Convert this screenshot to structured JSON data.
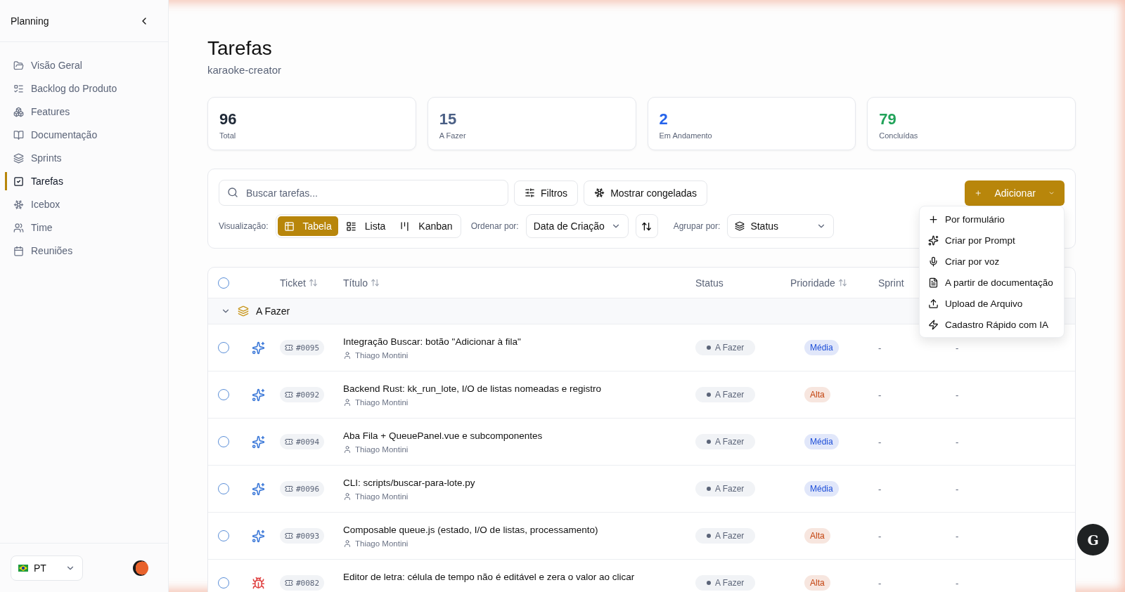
{
  "sidebar": {
    "title": "Planning",
    "items": [
      {
        "label": "Visão Geral",
        "selected": false
      },
      {
        "label": "Backlog do Produto",
        "selected": false
      },
      {
        "label": "Features",
        "selected": false
      },
      {
        "label": "Documentação",
        "selected": false
      },
      {
        "label": "Sprints",
        "selected": false
      },
      {
        "label": "Tarefas",
        "selected": true
      },
      {
        "label": "Icebox",
        "selected": false
      },
      {
        "label": "Time",
        "selected": false
      },
      {
        "label": "Reuniões",
        "selected": false
      }
    ],
    "language": "PT"
  },
  "header": {
    "title": "Tarefas",
    "subtitle": "karaoke-creator"
  },
  "stats": [
    {
      "value": "96",
      "label": "Total",
      "color": "#1f2937"
    },
    {
      "value": "15",
      "label": "A Fazer",
      "color": "#4a5f85"
    },
    {
      "value": "2",
      "label": "Em Andamento",
      "color": "#2563eb"
    },
    {
      "value": "79",
      "label": "Concluídas",
      "color": "#22a35a"
    }
  ],
  "toolbar": {
    "search_placeholder": "Buscar tarefas...",
    "filters": "Filtros",
    "frozen": "Mostrar congeladas",
    "add": "Adicionar",
    "view_label": "Visualização:",
    "views": [
      {
        "label": "Tabela",
        "selected": true
      },
      {
        "label": "Lista",
        "selected": false
      },
      {
        "label": "Kanban",
        "selected": false
      }
    ],
    "sort_label": "Ordenar por:",
    "sort_value": "Data de Criação",
    "group_label": "Agrupar por:",
    "group_value": "Status"
  },
  "add_menu": {
    "items": [
      {
        "label": "Por formulário"
      },
      {
        "label": "Criar por Prompt"
      },
      {
        "label": "Criar por voz"
      },
      {
        "label": "A partir de documentação"
      },
      {
        "label": "Upload de Arquivo"
      },
      {
        "label": "Cadastro Rápido com IA"
      }
    ]
  },
  "table": {
    "all_selected": false,
    "columns": [
      {
        "label": "Ticket",
        "sortable": true
      },
      {
        "label": "Título",
        "sortable": true
      },
      {
        "label": "Status",
        "sortable": false
      },
      {
        "label": "Prioridade",
        "sortable": true
      },
      {
        "label": "Sprint",
        "sortable": false
      }
    ],
    "group": {
      "label": "A Fazer",
      "expanded": true
    },
    "rows": [
      {
        "kind": "feature",
        "selected": false,
        "ticket": "#0095",
        "title": "Integração Buscar: botão \"Adicionar à fila\"",
        "author": "Thiago Montini",
        "status": "A Fazer",
        "priority": {
          "label": "Média",
          "color": "#1d4ed8"
        },
        "sprint": "-",
        "column_6": "-"
      },
      {
        "kind": "feature",
        "selected": false,
        "ticket": "#0092",
        "title": "Backend Rust: kk_run_lote, I/O de listas nomeadas e registro",
        "author": "Thiago Montini",
        "status": "A Fazer",
        "priority": {
          "label": "Alta",
          "color": "#c2410c"
        },
        "sprint": "-",
        "column_6": "-"
      },
      {
        "kind": "feature",
        "selected": false,
        "ticket": "#0094",
        "title": "Aba Fila + QueuePanel.vue e subcomponentes",
        "author": "Thiago Montini",
        "status": "A Fazer",
        "priority": {
          "label": "Média",
          "color": "#1d4ed8"
        },
        "sprint": "-",
        "column_6": "-"
      },
      {
        "kind": "feature",
        "selected": false,
        "ticket": "#0096",
        "title": "CLI: scripts/buscar-para-lote.py",
        "author": "Thiago Montini",
        "status": "A Fazer",
        "priority": {
          "label": "Média",
          "color": "#1d4ed8"
        },
        "sprint": "-",
        "column_6": "-"
      },
      {
        "kind": "feature",
        "selected": false,
        "ticket": "#0093",
        "title": "Composable queue.js (estado, I/O de listas, processamento)",
        "author": "Thiago Montini",
        "status": "A Fazer",
        "priority": {
          "label": "Alta",
          "color": "#c2410c"
        },
        "sprint": "-",
        "column_6": "-"
      },
      {
        "kind": "bug",
        "selected": false,
        "ticket": "#0082",
        "title": "Editor de letra: célula de tempo não é editável e zera o valor ao clicar",
        "status": "A Fazer",
        "priority": {
          "label": "Alta",
          "color": "#c2410c"
        },
        "sprint": "-",
        "column_6": "-"
      }
    ]
  },
  "assistant_button": "G"
}
